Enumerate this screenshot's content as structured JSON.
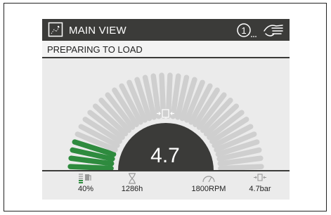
{
  "header": {
    "title": "MAIN VIEW",
    "alert_count": "1",
    "icons": [
      "view-icon",
      "alert-icon",
      "hand-icon"
    ]
  },
  "status": {
    "text": "PREPARING TO LOAD"
  },
  "gauge": {
    "value": "4.7",
    "icon": "load-indicator-icon",
    "fill_fraction": 0.1,
    "colors": {
      "active": "#2e8b3e",
      "inactive": "#cfcfcf",
      "center": "#3b3b39"
    }
  },
  "footer": {
    "fuel": {
      "value": "40%",
      "icon": "fuel-icon",
      "level_fraction": 0.4
    },
    "hours": {
      "value": "1286h",
      "icon": "hourglass-icon"
    },
    "rpm": {
      "value": "1800RPM",
      "icon": "speedometer-icon"
    },
    "pressure": {
      "value": "4.7bar",
      "icon": "pressure-icon"
    }
  }
}
